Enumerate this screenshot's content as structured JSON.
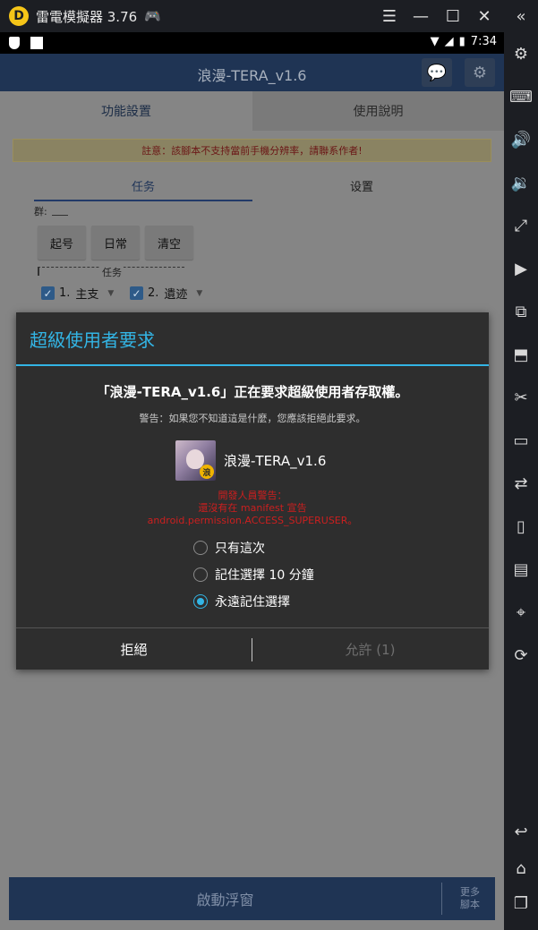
{
  "emulator": {
    "logo": "D",
    "title": "雷電模擬器 3.76",
    "controls": [
      {
        "name": "menu-icon",
        "glyph": "☰"
      },
      {
        "name": "minimize-icon",
        "glyph": "—"
      },
      {
        "name": "maximize-icon",
        "glyph": "☐"
      },
      {
        "name": "close-icon",
        "glyph": "✕"
      }
    ],
    "sidebar_icons": [
      {
        "name": "collapse-icon",
        "glyph": "«"
      },
      {
        "name": "settings-icon",
        "glyph": "⚙"
      },
      {
        "name": "keyboard-icon",
        "glyph": "⌨"
      },
      {
        "name": "volume-up-icon",
        "glyph": "🔊"
      },
      {
        "name": "volume-down-icon",
        "glyph": "🔉"
      },
      {
        "name": "fullscreen-icon",
        "glyph": "⤢"
      },
      {
        "name": "record-icon",
        "glyph": "▶"
      },
      {
        "name": "multi-instance-icon",
        "glyph": "⧉"
      },
      {
        "name": "apk-install-icon",
        "glyph": "⬒"
      },
      {
        "name": "scissors-icon",
        "glyph": "✂"
      },
      {
        "name": "video-icon",
        "glyph": "▭"
      },
      {
        "name": "sync-icon",
        "glyph": "⇄"
      },
      {
        "name": "shake-icon",
        "glyph": "▯"
      },
      {
        "name": "screen-icon",
        "glyph": "▤"
      },
      {
        "name": "location-icon",
        "glyph": "⌖"
      },
      {
        "name": "rotate-icon",
        "glyph": "⟳"
      },
      {
        "name": "back-icon",
        "glyph": "↩"
      },
      {
        "name": "home-icon",
        "glyph": "⌂"
      },
      {
        "name": "recent-apps-icon",
        "glyph": "❐"
      }
    ]
  },
  "statusbar": {
    "time": "7:34"
  },
  "app": {
    "title": "浪漫-TERA_v1.6",
    "tabs": [
      "功能設置",
      "使用說明"
    ],
    "notice": "註意：該腳本不支持當前手機分辨率，請聯系作者!",
    "subtabs": [
      "任务",
      "设置"
    ],
    "group_label": "群:",
    "buttons": [
      "起号",
      "日常",
      "清空"
    ],
    "task_section_label": "任务",
    "tasks": [
      {
        "num": "1.",
        "value": "主支"
      },
      {
        "num": "2.",
        "value": "遺迹"
      }
    ],
    "bottom": {
      "start_label": "啟動浮窗",
      "more_line1": "更多",
      "more_line2": "腳本"
    }
  },
  "dialog": {
    "title": "超級使用者要求",
    "heading": "「浪漫-TERA_v1.6」正在要求超級使用者存取權。",
    "warning": "警告：如果您不知道這是什麼，您應該拒絕此要求。",
    "app_name": "浪漫-TERA_v1.6",
    "app_icon_badge": "浪",
    "dev_warning_1": "開發人員警告：",
    "dev_warning_2": "還沒有在 manifest 宣告",
    "dev_warning_3": "android.permission.ACCESS_SUPERUSER。",
    "options": [
      "只有這次",
      "記住選擇 10 分鐘",
      "永遠記住選擇"
    ],
    "selected_option": "永遠記住選擇",
    "deny_label": "拒絕",
    "allow_label": "允許 (1)",
    "colors": {
      "accent": "#33b5e5",
      "dev_warning": "#cc1f1f"
    }
  }
}
